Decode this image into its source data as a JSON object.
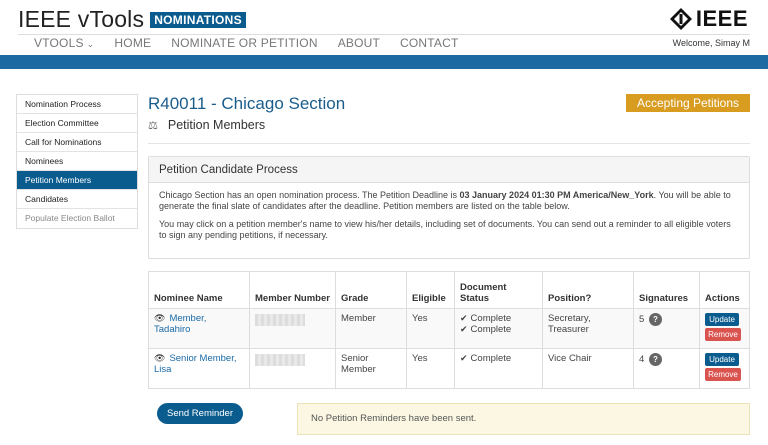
{
  "header": {
    "brand_title": "IEEE vTools",
    "brand_badge": "NOMINATIONS",
    "logo_text": "IEEE",
    "welcome": "Welcome, Simay M"
  },
  "nav": {
    "items": [
      "VTOOLS",
      "HOME",
      "NOMINATE OR PETITION",
      "ABOUT",
      "CONTACT"
    ]
  },
  "sidebar": {
    "items": [
      "Nomination Process",
      "Election Committee",
      "Call for Nominations",
      "Nominees",
      "Petition Members",
      "Candidates",
      "Populate Election Ballot"
    ],
    "active_index": 4
  },
  "page": {
    "title": "R40011 - Chicago Section",
    "status": "Accepting Petitions",
    "subtitle": "Petition Members"
  },
  "panel": {
    "heading": "Petition Candidate Process",
    "para1_a": "Chicago Section has an open nomination process. The Petition Deadline is ",
    "para1_deadline": "03 January 2024 01:30 PM America/New_York",
    "para1_b": ". You will be able to generate the final slate of candidates after the deadline. Petition members are listed on the table below.",
    "para2": "You may click on a petition member's name to view his/her details, including set of documents. You can send out a reminder to all eligible voters to sign any pending petitions, if necessary."
  },
  "table": {
    "headers": [
      "Nominee Name",
      "Member Number",
      "Grade",
      "Eligible",
      "Document Status",
      "Position?",
      "Signatures",
      "Actions"
    ],
    "rows": [
      {
        "name": "Member, Tadahiro",
        "grade": "Member",
        "eligible": "Yes",
        "doc1": "Complete",
        "doc2": "Complete",
        "position": "Secretary, Treasurer",
        "signatures": "5",
        "update": "Update",
        "remove": "Remove"
      },
      {
        "name": "Senior Member, Lisa",
        "grade": "Senior Member",
        "eligible": "Yes",
        "doc1": "Complete",
        "position": "Vice Chair",
        "signatures": "4",
        "update": "Update",
        "remove": "Remove"
      }
    ],
    "help_glyph": "?"
  },
  "footer": {
    "send_button": "Send Reminder",
    "alert": "No Petition Reminders have been sent."
  },
  "colors": {
    "brand_blue": "#0b5c8e",
    "link_blue": "#1a6aa6",
    "accent_gold": "#d89c20",
    "danger_red": "#d9534f"
  },
  "icons": [
    "chevron-down-icon",
    "eye-icon",
    "check-icon",
    "balance-scale-icon",
    "ieee-diamond-logo"
  ]
}
